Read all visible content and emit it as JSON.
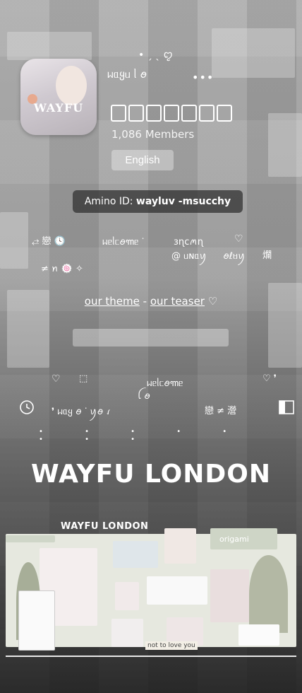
{
  "header": {
    "deco_top": "• ˏ ˎ ꨄ",
    "title": "ᥕᥲყᥙ ᥣ  ꪮ",
    "more_label": "•••"
  },
  "community": {
    "members": "1,086 Members",
    "language": "English",
    "amino_id_label": "Amino ID:",
    "amino_id": "wayluv -msucchy",
    "level_segments": 7
  },
  "bio": {
    "row1_a": "⥄  戀 🕓",
    "row1_b": "ᥕᥱᥣᥴꪮ꧑ᥱ ᐝ",
    "row1_c": "ɜɳcꪔɳ",
    "row1_d": "♡",
    "row2_a": "@ ᥙɴᥲꪗ",
    "row2_b": "ꪮℓᥛꪗ",
    "row2_c": "爛",
    "row3": "≠   ꪀ 🍥  ✧"
  },
  "links": {
    "theme": "our theme",
    "sep": " - ",
    "teaser": "our teaser",
    "heart": "♡"
  },
  "section2": {
    "row1_a": "♡",
    "row1_b": "⬚",
    "row1_c": "ᥕᥱᥣᥴꪮ꧑ᥱ",
    "row1_d": "♡  ❜",
    "row2_a": "ꪶ   ꪮ",
    "row3": "❜ ᥕᥲყ ꪮ ᐝ   ꪗꪮ    ꪹ",
    "row3_b": "戀  ≠   瀯",
    "dots": "• • • • • • • •"
  },
  "banner": {
    "headline": "WAYFU LONDON",
    "collage_title": "WAYFU LONDON",
    "tag_origami": "origami",
    "tag_notes": "not to love you"
  },
  "colors": {
    "bg_dark": "#1a1a1a",
    "chip": "#323232",
    "text": "#ffffff"
  }
}
